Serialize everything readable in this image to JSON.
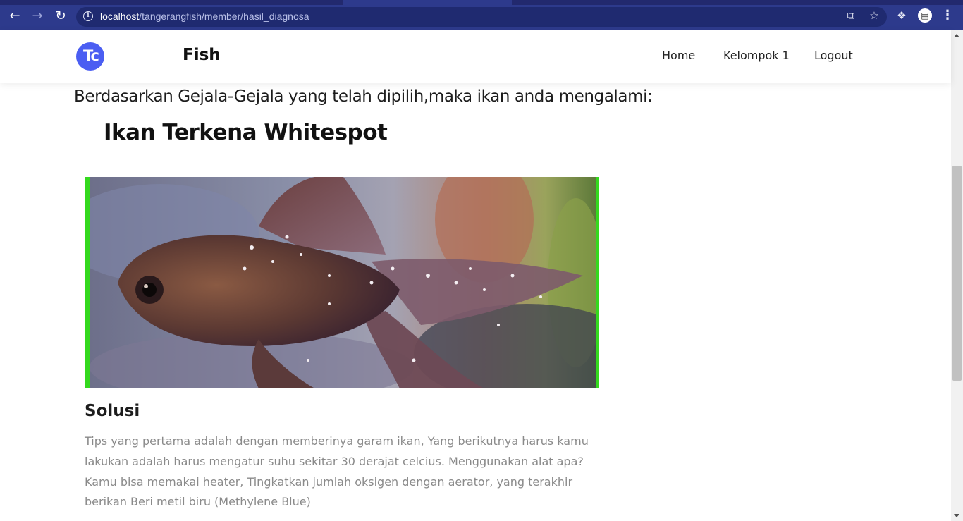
{
  "browser": {
    "url_host": "localhost",
    "url_path": "/tangerangfish/member/hasil_diagnosa",
    "icons": [
      "back-arrow-icon",
      "forward-arrow-icon",
      "reload-icon",
      "info-icon",
      "share-icon",
      "star-icon",
      "extensions-icon",
      "profile-icon",
      "menu-icon"
    ]
  },
  "header": {
    "logo_text": "Tc",
    "brand": "Fish",
    "nav": [
      "Home",
      "Kelompok 1",
      "Logout"
    ],
    "accent_color": "#4b5ef2"
  },
  "main": {
    "lead": "Berdasarkan Gejala-Gejala yang telah dipilih,maka ikan anda mengalami:",
    "diagnosis": "Ikan Terkena Whitespot",
    "image_alt": "goldfish with white spots",
    "solution_title": "Solusi",
    "solution_text": "Tips yang pertama adalah dengan memberinya garam ikan, Yang berikutnya harus kamu lakukan adalah harus mengatur suhu sekitar 30 derajat celcius. Menggunakan alat apa? Kamu bisa memakai heater, Tingkatkan jumlah oksigen dengan aerator, yang terakhir berikan Beri metil biru (Methylene Blue)"
  }
}
